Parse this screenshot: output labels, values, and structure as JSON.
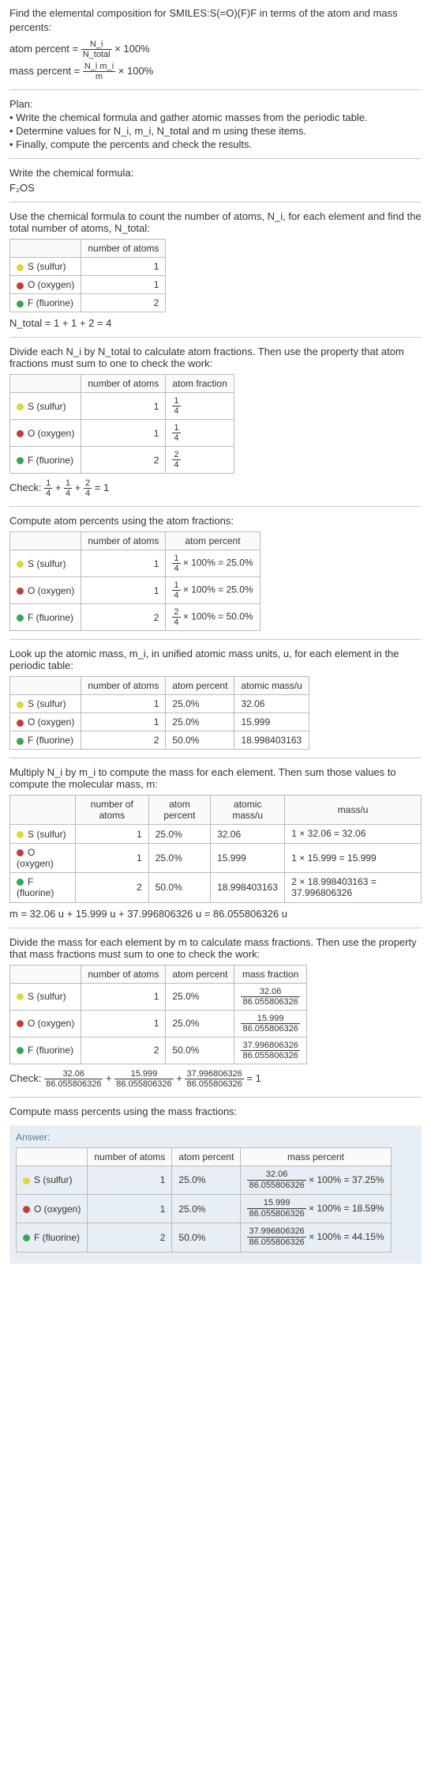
{
  "intro": {
    "prompt": "Find the elemental composition for SMILES:S(=O)(F)F in terms of the atom and mass percents:",
    "atom_percent_lhs": "atom percent = ",
    "atom_percent_num": "N_i",
    "atom_percent_den": "N_total",
    "times100": " × 100%",
    "mass_percent_lhs": "mass percent = ",
    "mass_percent_num": "N_i m_i",
    "mass_percent_den": "m"
  },
  "plan": {
    "title": "Plan:",
    "item1": "• Write the chemical formula and gather atomic masses from the periodic table.",
    "item2": "• Determine values for N_i, m_i, N_total and m using these items.",
    "item3": "• Finally, compute the percents and check the results."
  },
  "step1": {
    "title": "Write the chemical formula:",
    "formula": "F₂OS"
  },
  "step2": {
    "title": "Use the chemical formula to count the number of atoms, N_i, for each element and find the total number of atoms, N_total:",
    "h_number": "number of atoms",
    "s_label": "S (sulfur)",
    "s_n": "1",
    "o_label": "O (oxygen)",
    "o_n": "1",
    "f_label": "F (fluorine)",
    "f_n": "2",
    "total": "N_total = 1 + 1 + 2 = 4"
  },
  "step3": {
    "title": "Divide each N_i by N_total to calculate atom fractions. Then use the property that atom fractions must sum to one to check the work:",
    "h_number": "number of atoms",
    "h_frac": "atom fraction",
    "s_n": "1",
    "s_frac_num": "1",
    "s_frac_den": "4",
    "o_n": "1",
    "o_frac_num": "1",
    "o_frac_den": "4",
    "f_n": "2",
    "f_frac_num": "2",
    "f_frac_den": "4",
    "check": "Check: ¼ + ¼ + 2/4 = 1",
    "check_prefix": "Check: ",
    "check_eq": " = 1"
  },
  "step4": {
    "title": "Compute atom percents using the atom fractions:",
    "h_number": "number of atoms",
    "h_pct": "atom percent",
    "s_n": "1",
    "s_pct": " × 100% = 25.0%",
    "s_num": "1",
    "s_den": "4",
    "o_n": "1",
    "o_pct": " × 100% = 25.0%",
    "o_num": "1",
    "o_den": "4",
    "f_n": "2",
    "f_pct": " × 100% = 50.0%",
    "f_num": "2",
    "f_den": "4"
  },
  "step5": {
    "title": "Look up the atomic mass, m_i, in unified atomic mass units, u, for each element in the periodic table:",
    "h_number": "number of atoms",
    "h_pct": "atom percent",
    "h_mass": "atomic mass/u",
    "s_n": "1",
    "s_pct": "25.0%",
    "s_mass": "32.06",
    "o_n": "1",
    "o_pct": "25.0%",
    "o_mass": "15.999",
    "f_n": "2",
    "f_pct": "50.0%",
    "f_mass": "18.998403163"
  },
  "step6": {
    "title": "Multiply N_i by m_i to compute the mass for each element. Then sum those values to compute the molecular mass, m:",
    "h_number": "number of atoms",
    "h_pct": "atom percent",
    "h_amu": "atomic mass/u",
    "h_mass": "mass/u",
    "s_n": "1",
    "s_pct": "25.0%",
    "s_amu": "32.06",
    "s_mass": "1 × 32.06 = 32.06",
    "o_n": "1",
    "o_pct": "25.0%",
    "o_amu": "15.999",
    "o_mass": "1 × 15.999 = 15.999",
    "f_n": "2",
    "f_pct": "50.0%",
    "f_amu": "18.998403163",
    "f_mass": "2 × 18.998403163 = 37.996806326",
    "total": "m = 32.06 u + 15.999 u + 37.996806326 u = 86.055806326 u"
  },
  "step7": {
    "title": "Divide the mass for each element by m to calculate mass fractions. Then use the property that mass fractions must sum to one to check the work:",
    "h_number": "number of atoms",
    "h_pct": "atom percent",
    "h_mf": "mass fraction",
    "s_n": "1",
    "s_pct": "25.0%",
    "s_num": "32.06",
    "s_den": "86.055806326",
    "o_n": "1",
    "o_pct": "25.0%",
    "o_num": "15.999",
    "o_den": "86.055806326",
    "f_n": "2",
    "f_pct": "50.0%",
    "f_num": "37.996806326",
    "f_den": "86.055806326",
    "check_prefix": "Check: ",
    "check_eq": " = 1"
  },
  "step8": {
    "title": "Compute mass percents using the mass fractions:"
  },
  "answer": {
    "label": "Answer:",
    "h_number": "number of atoms",
    "h_pct": "atom percent",
    "h_mp": "mass percent",
    "s_label": "S (sulfur)",
    "s_n": "1",
    "s_pct": "25.0%",
    "s_num": "32.06",
    "s_den": "86.055806326",
    "s_res": " × 100% = 37.25%",
    "o_label": "O (oxygen)",
    "o_n": "1",
    "o_pct": "25.0%",
    "o_num": "15.999",
    "o_den": "86.055806326",
    "o_res": " × 100% = 18.59%",
    "f_label": "F (fluorine)",
    "f_n": "2",
    "f_pct": "50.0%",
    "f_num": "37.996806326",
    "f_den": "86.055806326",
    "f_res": " × 100% = 44.15%"
  }
}
